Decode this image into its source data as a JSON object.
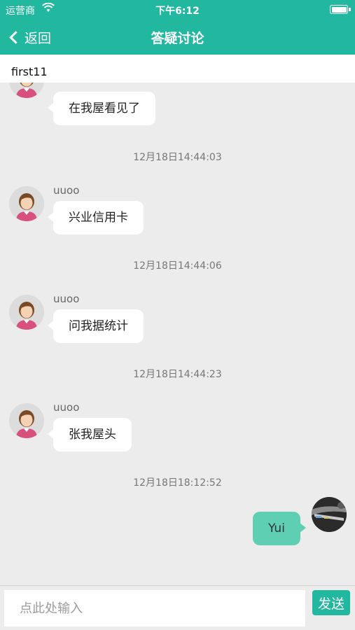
{
  "status_bar": {
    "carrier": "运营商",
    "time": "下午6:12"
  },
  "nav": {
    "back_label": "返回",
    "title": "答疑讨论"
  },
  "topic": {
    "name": "first11"
  },
  "messages": [
    {
      "type": "incoming",
      "sender": "",
      "text": "在我屋看见了"
    },
    {
      "type": "timestamp",
      "text": "12月18日14:44:03"
    },
    {
      "type": "incoming",
      "sender": "uuoo",
      "text": "兴业信用卡"
    },
    {
      "type": "timestamp",
      "text": "12月18日14:44:06"
    },
    {
      "type": "incoming",
      "sender": "uuoo",
      "text": "问我据统计"
    },
    {
      "type": "timestamp",
      "text": "12月18日14:44:23"
    },
    {
      "type": "incoming",
      "sender": "uuoo",
      "text": "张我屋头"
    },
    {
      "type": "timestamp",
      "text": "12月18日18:12:52"
    },
    {
      "type": "outgoing",
      "sender": "",
      "text": "Yui"
    }
  ],
  "input": {
    "placeholder": "点此处输入",
    "send_label": "发送"
  },
  "colors": {
    "brand": "#22b8a0",
    "outgoing_bubble": "#5ecfb3",
    "background": "#ececec"
  }
}
